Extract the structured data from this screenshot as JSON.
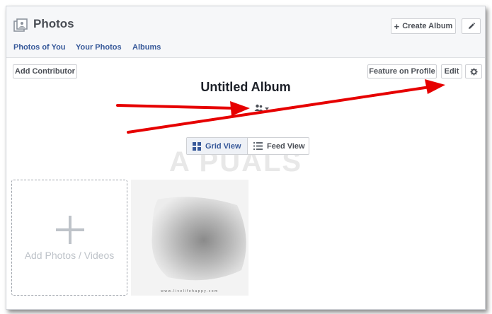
{
  "header": {
    "title": "Photos",
    "create_album_label": "Create Album",
    "create_album_glyph": "+",
    "pencil_icon": "pencil-icon",
    "nav": [
      "Photos of You",
      "Your Photos",
      "Albums"
    ]
  },
  "toolbar": {
    "add_contributor": "Add Contributor",
    "feature_on_profile": "Feature on Profile",
    "edit": "Edit",
    "settings_icon": "gear-icon"
  },
  "album": {
    "title": "Untitled Album",
    "privacy_icon": "people-icon"
  },
  "view_toggle": {
    "grid": "Grid View",
    "feed": "Feed View",
    "selected": "Grid View"
  },
  "watermark": "A PUALS",
  "grid": {
    "add_label": "Add Photos / Videos",
    "photo_caption": "www.livelifehappy.com"
  },
  "colors": {
    "link": "#365899",
    "arrow": "#e60000"
  }
}
